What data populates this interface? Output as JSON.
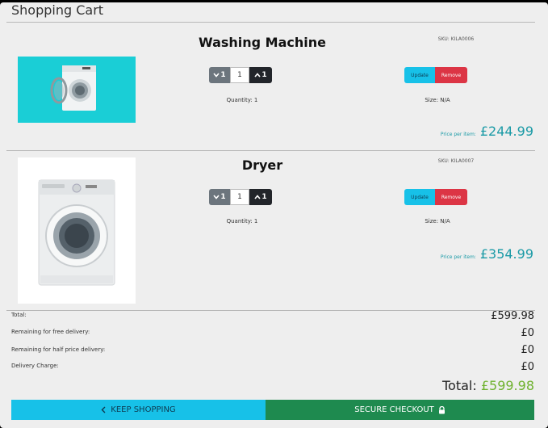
{
  "header": {
    "title": "Shopping Cart"
  },
  "items": [
    {
      "name": "Washing Machine",
      "sku": "SKU: KILA0006",
      "quantity": "1",
      "dec_label": "1",
      "inc_label": "1",
      "update_label": "Update",
      "remove_label": "Remove",
      "quantity_text": "Quantity: 1",
      "size_text": "Size: N/A",
      "price_label": "Price per item:",
      "price": "£244.99"
    },
    {
      "name": "Dryer",
      "sku": "SKU: KILA0007",
      "quantity": "1",
      "dec_label": "1",
      "inc_label": "1",
      "update_label": "Update",
      "remove_label": "Remove",
      "quantity_text": "Quantity: 1",
      "size_text": "Size: N/A",
      "price_label": "Price per item:",
      "price": "£354.99"
    }
  ],
  "summary": {
    "total_label": "Total:",
    "total_value": "£599.98",
    "free_delivery_label": "Remaining for free delivery:",
    "free_delivery_value": "£0",
    "half_price_label": "Remaining for half price delivery:",
    "half_price_value": "£0",
    "delivery_charge_label": "Delivery Charge:",
    "delivery_charge_value": "£0",
    "grand_total_label": "Total:",
    "grand_total_value": "£599.98"
  },
  "actions": {
    "keep_shopping": "KEEP SHOPPING",
    "secure_checkout": "SECURE CHECKOUT"
  },
  "icons": {
    "chevron": "chevron-left-icon",
    "lock": "lock-icon",
    "down": "chevron-down-icon",
    "up": "chevron-up-icon"
  },
  "colors": {
    "accent_teal": "#1a9aa6",
    "update_blue": "#17c1e8",
    "remove_red": "#dc3545",
    "checkout_green": "#1e8a4f",
    "total_green": "#6fb22f"
  }
}
